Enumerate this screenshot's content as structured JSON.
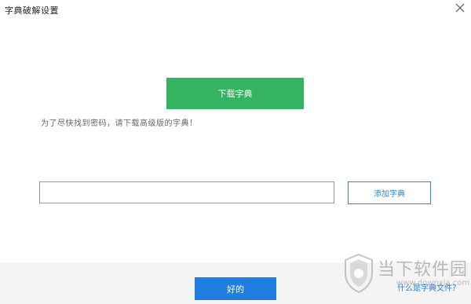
{
  "window": {
    "title": "字典破解设置",
    "close_icon": "close-icon"
  },
  "main": {
    "download_button_label": "下载字典",
    "hint_text": "为了尽快找到密码，请下载高级版的字典！",
    "dictionary_path_value": "",
    "add_dictionary_label": "添加字典"
  },
  "footer": {
    "ok_button_label": "好的",
    "what_is_dictionary_link": "什么是字典文件？"
  },
  "watermark": {
    "brand": "当下软件园",
    "domain": "www.downxia.com"
  },
  "colors": {
    "download_green": "#34b360",
    "primary_blue": "#1f7ee0",
    "outline_blue": "#2f86c8",
    "footer_gray": "#f4f4f4"
  }
}
